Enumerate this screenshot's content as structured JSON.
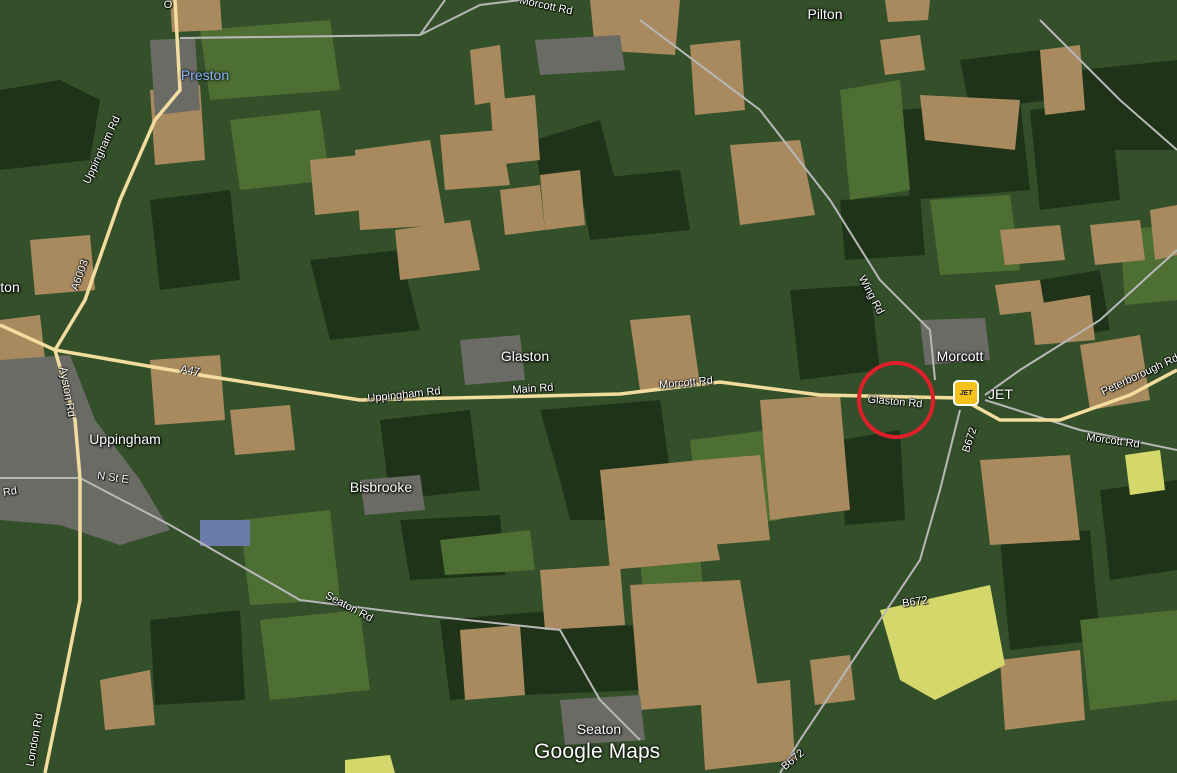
{
  "map": {
    "attribution_brand": "Google",
    "attribution_product": "Maps",
    "places": {
      "preston": "Preston",
      "pilton": "Pilton",
      "glaston": "Glaston",
      "morcott": "Morcott",
      "uppingham": "Uppingham",
      "bisbrooke": "Bisbrooke",
      "seaton": "Seaton",
      "edge_left": "ton"
    },
    "roads": {
      "uppingham_rd_north": "Uppingham Rd",
      "a6003": "A6003",
      "a47": "A47",
      "ayston_rd": "Ayston Rd",
      "uppingham_rd_east": "Uppingham Rd",
      "main_rd": "Main Rd",
      "morcott_rd_west": "Morcott Rd",
      "glaston_rd": "Glaston Rd",
      "wing_rd": "Wing Rd",
      "morcott_rd_top": "Morcott Rd",
      "peterborough_rd": "Peterborough Rd",
      "morcott_rd_east": "Morcott Rd",
      "b672_north": "B672",
      "b672_mid": "B672",
      "b672_south": "B672",
      "n_st_e": "N St E",
      "rd_left": "Rd",
      "seaton_rd": "Seaton Rd",
      "london_rd": "London Rd",
      "top_o": "O"
    },
    "poi": {
      "jet_station": "JET",
      "jet_icon_text": "JET"
    },
    "highlight": {
      "color": "#e0202a",
      "target": "Glaston Rd"
    },
    "colors": {
      "main_road": "#f2dc9e",
      "minor_road": "#b8b8b8",
      "field_green": "#3d5e2a",
      "field_brown": "#a98a5f",
      "rapeseed": "#d9db6a",
      "town": "#6b6b66"
    }
  }
}
